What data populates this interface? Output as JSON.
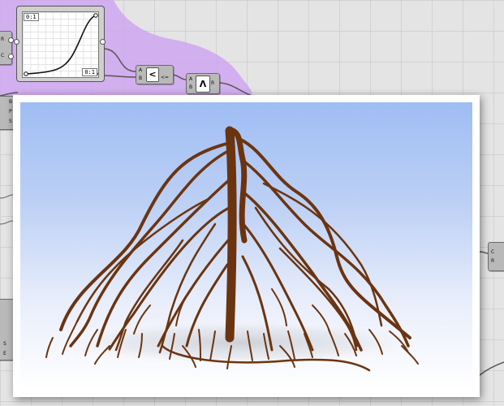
{
  "graph_mapper": {
    "top_range_label": "0:1",
    "bottom_range_label": "0:1",
    "curve": "sigmoid"
  },
  "nodes": {
    "left_node_top": {
      "ports": [
        "R",
        "C"
      ]
    },
    "less_than": {
      "inputs": [
        "A",
        "B"
      ],
      "symbol": "<",
      "output": "<="
    },
    "and_gate": {
      "inputs": [
        "A",
        "B"
      ],
      "symbol": "Λ",
      "output": "R"
    },
    "left_node_mid": {
      "ports": [
        "B",
        "P",
        "S"
      ]
    },
    "left_node_low": {
      "ports": [
        "S",
        "E"
      ]
    },
    "right_node": {
      "ports": [
        "C",
        "R"
      ]
    }
  },
  "render_preview": {
    "subject": "branching root system",
    "colors": {
      "sky_top": "#9fbdf3",
      "sky_bottom": "#ffffff",
      "root": "#6b3410",
      "group_highlight": "#cfa6f0"
    }
  }
}
